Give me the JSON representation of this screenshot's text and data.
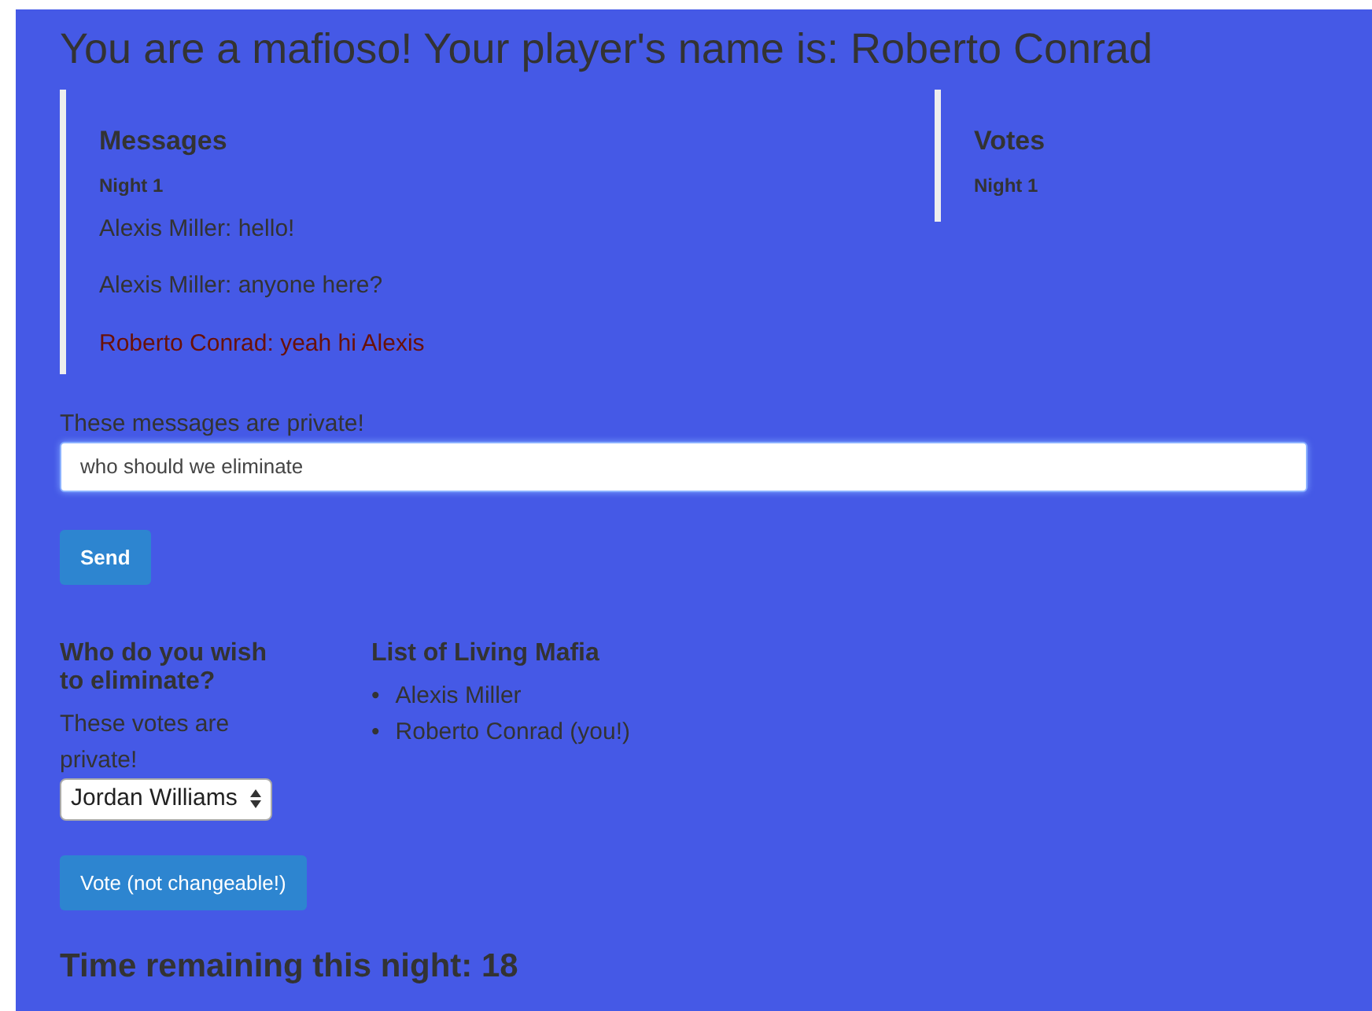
{
  "title": "You are a mafioso! Your player's name is: Roberto Conrad",
  "messages": {
    "heading": "Messages",
    "night": "Night 1",
    "items": [
      {
        "text": "Alexis Miller: hello!",
        "mine": false
      },
      {
        "text": "Alexis Miller: anyone here?",
        "mine": false
      },
      {
        "text": "Roberto Conrad: yeah hi Alexis",
        "mine": true
      }
    ]
  },
  "votes": {
    "heading": "Votes",
    "night": "Night 1"
  },
  "privacy_note": "These messages are private!",
  "message_field": {
    "value": "who should we eliminate",
    "focused": true
  },
  "send_button": "Send",
  "eliminate": {
    "heading": "Who do you wish to eliminate?",
    "note": "These votes are private!",
    "choice": "Jordan Williams"
  },
  "living_mafia": {
    "heading": "List of Living Mafia",
    "bullet": "•",
    "members": [
      "Alexis Miller",
      "Roberto Conrad (you!)"
    ]
  },
  "vote_button": "Vote (not changeable!)",
  "timer": "Time remaining this night: 18"
}
